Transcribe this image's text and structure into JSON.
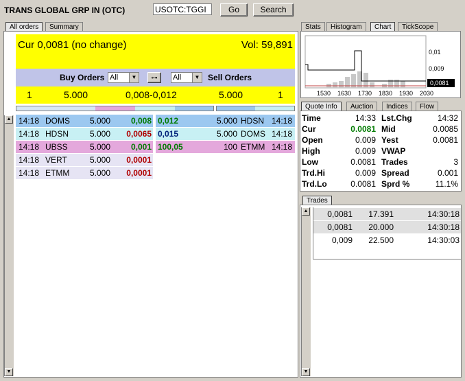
{
  "header": {
    "title": "TRANS GLOBAL GRP IN (OTC)",
    "symbol": "USOTC:TGGI",
    "go_label": "Go",
    "search_label": "Search"
  },
  "left_tabs": [
    "All orders",
    "Summary"
  ],
  "quote_banner": {
    "cur": "Cur 0,0081 (no change)",
    "vol": "Vol: 59,891"
  },
  "order_header": {
    "buy_label": "Buy Orders",
    "buy_filter": "All",
    "sell_filter": "All",
    "sell_label": "Sell Orders"
  },
  "summary_line": {
    "buy_count": "1",
    "buy_size": "5.000",
    "spread": "0,008-0,012",
    "sell_size": "5.000",
    "sell_count": "1"
  },
  "buy_orders": [
    {
      "time": "14:18",
      "mm": "DOMS",
      "size": "5.000",
      "price": "0,008",
      "tone": "green",
      "bg": "#9cc8f0"
    },
    {
      "time": "14:18",
      "mm": "HDSN",
      "size": "5.000",
      "price": "0,0065",
      "tone": "red",
      "bg": "#c8f0f4"
    },
    {
      "time": "14:18",
      "mm": "UBSS",
      "size": "5.000",
      "price": "0,001",
      "tone": "green",
      "bg": "#e4a8dc"
    },
    {
      "time": "14:18",
      "mm": "VERT",
      "size": "5.000",
      "price": "0,0001",
      "tone": "red",
      "bg": "#e6e4f4"
    },
    {
      "time": "14:18",
      "mm": "ETMM",
      "size": "5.000",
      "price": "0,0001",
      "tone": "red",
      "bg": "#e6e4f4"
    }
  ],
  "sell_orders": [
    {
      "price": "0,012",
      "tone": "green",
      "size": "5.000",
      "mm": "HDSN",
      "time": "14:18",
      "bg": "#9cc8f0"
    },
    {
      "price": "0,015",
      "tone": "blue",
      "size": "5.000",
      "mm": "DOMS",
      "time": "14:18",
      "bg": "#c8f0f4"
    },
    {
      "price": "100,05",
      "tone": "green",
      "size": "100",
      "mm": "ETMM",
      "time": "14:18",
      "bg": "#e4a8dc"
    }
  ],
  "right_tabs": [
    "Stats",
    "Histogram",
    "Chart",
    "TickScope"
  ],
  "chart_data": {
    "type": "line",
    "x_ticks": [
      "1530",
      "1630",
      "1730",
      "1830",
      "1930",
      "2030"
    ],
    "y_ticks": [
      "0,01",
      "0,009"
    ],
    "last_value": "0,0081"
  },
  "info_tabs": [
    "Quote Info",
    "Auction",
    "Indices",
    "Flow"
  ],
  "quote_info": [
    {
      "l1": "Time",
      "v1": "14:33",
      "l2": "Lst.Chg",
      "v2": "14:32"
    },
    {
      "l1": "Cur",
      "v1": "0.0081",
      "l2": "Mid",
      "v2": "0.0085"
    },
    {
      "l1": "Open",
      "v1": "0.009",
      "l2": "Yest",
      "v2": "0.0081"
    },
    {
      "l1": "High",
      "v1": "0.009",
      "l2": "VWAP",
      "v2": ""
    },
    {
      "l1": "Low",
      "v1": "0.0081",
      "l2": "Trades",
      "v2": "3"
    },
    {
      "l1": "Trd.Hi",
      "v1": "0.009",
      "l2": "Spread",
      "v2": "0.001"
    },
    {
      "l1": "Trd.Lo",
      "v1": "0.0081",
      "l2": "Sprd %",
      "v2": "11.1%"
    }
  ],
  "trades_tab": "Trades",
  "trades": [
    {
      "price": "0,0081",
      "size": "17.391",
      "time": "14:30:18"
    },
    {
      "price": "0,0081",
      "size": "20.000",
      "time": "14:30:18"
    },
    {
      "price": "0,009",
      "size": "22.500",
      "time": "14:30:03"
    }
  ],
  "colors": {
    "green": "#007a00",
    "red": "#b00000",
    "blue": "#00207a",
    "banner": "#ffff00",
    "header_band": "#c0c4e8"
  }
}
